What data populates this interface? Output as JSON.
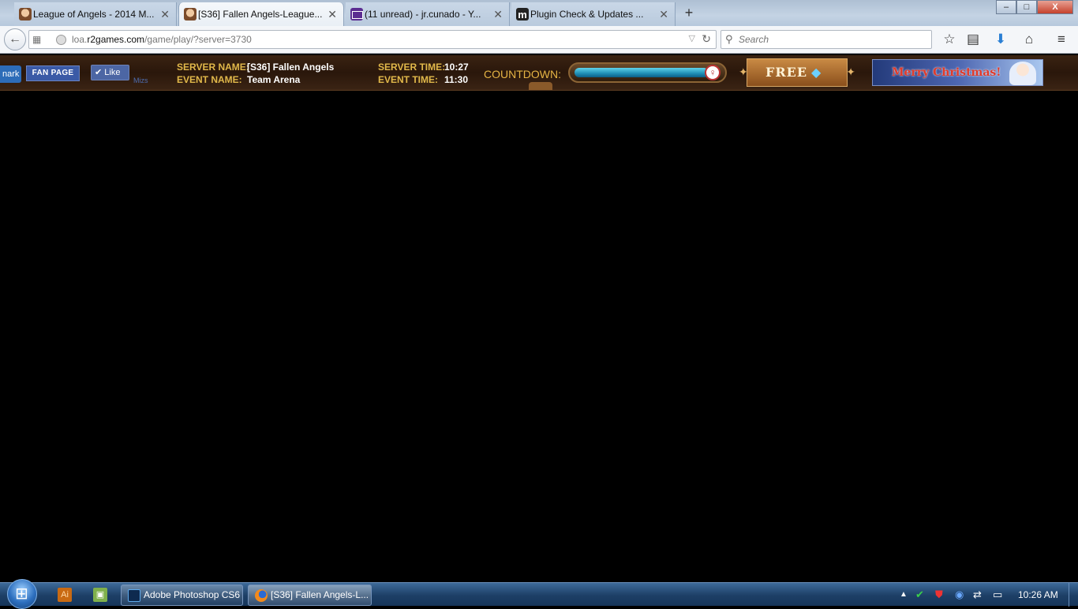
{
  "browser": {
    "tabs": [
      {
        "title": "League of Angels - 2014 M...",
        "favicon": "angel-favicon",
        "active": false
      },
      {
        "title": "[S36] Fallen Angels-League...",
        "favicon": "angel-favicon",
        "active": true
      },
      {
        "title": "(11 unread) - jr.cunado - Y...",
        "favicon": "mail-favicon",
        "active": false
      },
      {
        "title": "Plugin Check & Updates ...",
        "favicon": "m-favicon",
        "active": false
      }
    ],
    "new_tab": "+",
    "window_controls": {
      "minimize": "–",
      "maximize": "□",
      "close": "X"
    },
    "url": {
      "domain_prefix": "loa.",
      "domain": "r2games.com",
      "path": "/game/play/?server=3730"
    },
    "search_placeholder": "Search"
  },
  "game_header": {
    "bookmark_label": "nark",
    "fan_page_label": "FAN PAGE",
    "like_label": "Like",
    "mizs_label": "Mizs",
    "server_name_label": "SERVER NAME:",
    "server_name_value": "[S36] Fallen Angels",
    "event_name_label": "EVENT NAME:",
    "event_name_value": "Team Arena",
    "server_time_label": "SERVER TIME:",
    "server_time_value": "10:27",
    "event_time_label": "EVENT TIME:",
    "event_time_value": "11:30",
    "countdown_label": "COUNTDOWN:",
    "countdown_progress": 0.92,
    "free_label": "FREE",
    "xmas_banner": "Merry Christmas!"
  },
  "taskbar": {
    "tasks": [
      {
        "label": "Adobe Photoshop CS6",
        "icon": "photoshop-icon"
      },
      {
        "label": "[S36] Fallen Angels-L...",
        "icon": "firefox-icon"
      }
    ],
    "clock": "10:26 AM"
  },
  "colors": {
    "gold_label": "#e1b84a",
    "game_bg": "#2a170b",
    "taskbar": "#1d3f66"
  }
}
